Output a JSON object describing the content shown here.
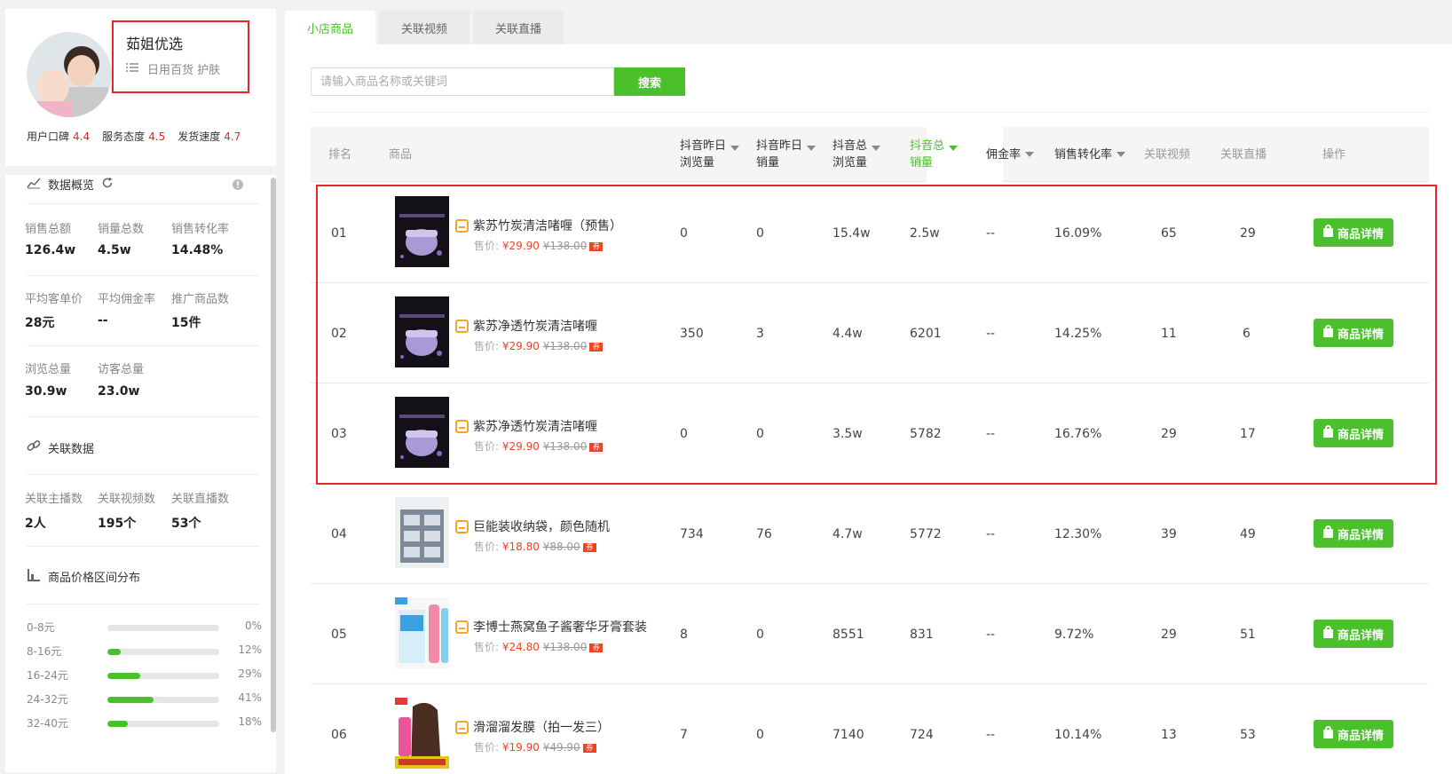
{
  "profile": {
    "shop_name": "茹姐优选",
    "categories": "日用百货 护肤",
    "ratings": [
      {
        "label": "用户口碑",
        "value": "4.4"
      },
      {
        "label": "服务态度",
        "value": "4.5"
      },
      {
        "label": "发货速度",
        "value": "4.7"
      }
    ]
  },
  "overview": {
    "title": "数据概览",
    "stats": [
      {
        "label": "销售总额",
        "value": "126.4w"
      },
      {
        "label": "销量总数",
        "value": "4.5w"
      },
      {
        "label": "销售转化率",
        "value": "14.48%"
      },
      {
        "label": "平均客单价",
        "value": "28元"
      },
      {
        "label": "平均佣金率",
        "value": "--"
      },
      {
        "label": "推广商品数",
        "value": "15件"
      },
      {
        "label": "浏览总量",
        "value": "30.9w"
      },
      {
        "label": "访客总量",
        "value": "23.0w"
      }
    ]
  },
  "related": {
    "title": "关联数据",
    "stats": [
      {
        "label": "关联主播数",
        "value": "2人"
      },
      {
        "label": "关联视频数",
        "value": "195个"
      },
      {
        "label": "关联直播数",
        "value": "53个"
      }
    ]
  },
  "price_dist": {
    "title": "商品价格区间分布",
    "ranges": [
      {
        "label": "0-8元",
        "percent": "0%",
        "fraction": 0.0
      },
      {
        "label": "8-16元",
        "percent": "12%",
        "fraction": 0.12
      },
      {
        "label": "16-24元",
        "percent": "29%",
        "fraction": 0.29
      },
      {
        "label": "24-32元",
        "percent": "41%",
        "fraction": 0.41
      },
      {
        "label": "32-40元",
        "percent": "18%",
        "fraction": 0.18
      }
    ]
  },
  "tabs": [
    "小店商品",
    "关联视频",
    "关联直播"
  ],
  "search": {
    "placeholder": "请输入商品名称或关键词",
    "button": "搜索"
  },
  "table": {
    "headers": {
      "rank": "排名",
      "product": "商品",
      "dy_yest_views_1": "抖音昨日",
      "dy_yest_views_2": "浏览量",
      "dy_yest_sales_1": "抖音昨日",
      "dy_yest_sales_2": "销量",
      "dy_total_views_1": "抖音总",
      "dy_total_views_2": "浏览量",
      "dy_total_sales_1": "抖音总",
      "dy_total_sales_2": "销量",
      "commission": "佣金率",
      "conversion": "销售转化率",
      "videos": "关联视频",
      "lives": "关联直播",
      "action": "操作"
    },
    "price_label": "售价:",
    "coupon_tag": "券",
    "detail_button": "商品详情",
    "rows": [
      {
        "rank": "01",
        "name": "紫苏竹炭清洁啫喱（预售）",
        "price": "¥29.90",
        "old_price": "¥138.00",
        "yest_views": "0",
        "yest_sales": "0",
        "total_views": "15.4w",
        "total_sales": "2.5w",
        "commission": "--",
        "conversion": "16.09%",
        "videos": "65",
        "lives": "29"
      },
      {
        "rank": "02",
        "name": "紫苏净透竹炭清洁啫喱",
        "price": "¥29.90",
        "old_price": "¥138.00",
        "yest_views": "350",
        "yest_sales": "3",
        "total_views": "4.4w",
        "total_sales": "6201",
        "commission": "--",
        "conversion": "14.25%",
        "videos": "11",
        "lives": "6"
      },
      {
        "rank": "03",
        "name": "紫苏净透竹炭清洁啫喱",
        "price": "¥29.90",
        "old_price": "¥138.00",
        "yest_views": "0",
        "yest_sales": "0",
        "total_views": "3.5w",
        "total_sales": "5782",
        "commission": "--",
        "conversion": "16.76%",
        "videos": "29",
        "lives": "17"
      },
      {
        "rank": "04",
        "name": "巨能装收纳袋，颜色随机",
        "price": "¥18.80",
        "old_price": "¥88.00",
        "yest_views": "734",
        "yest_sales": "76",
        "total_views": "4.7w",
        "total_sales": "5772",
        "commission": "--",
        "conversion": "12.30%",
        "videos": "39",
        "lives": "49"
      },
      {
        "rank": "05",
        "name": "李博士燕窝鱼子酱奢华牙膏套装",
        "price": "¥24.80",
        "old_price": "¥138.00",
        "yest_views": "8",
        "yest_sales": "0",
        "total_views": "8551",
        "total_sales": "831",
        "commission": "--",
        "conversion": "9.72%",
        "videos": "29",
        "lives": "51"
      },
      {
        "rank": "06",
        "name": "滑溜溜发膜（拍一发三）",
        "price": "¥19.90",
        "old_price": "¥49.90",
        "yest_views": "7",
        "yest_sales": "0",
        "total_views": "7140",
        "total_sales": "724",
        "commission": "--",
        "conversion": "10.14%",
        "videos": "13",
        "lives": "53"
      }
    ]
  },
  "colors": {
    "accent": "#4cbf2c",
    "highlight_border": "#e8252b",
    "price": "#ee4425",
    "rating": "#e8252b"
  }
}
